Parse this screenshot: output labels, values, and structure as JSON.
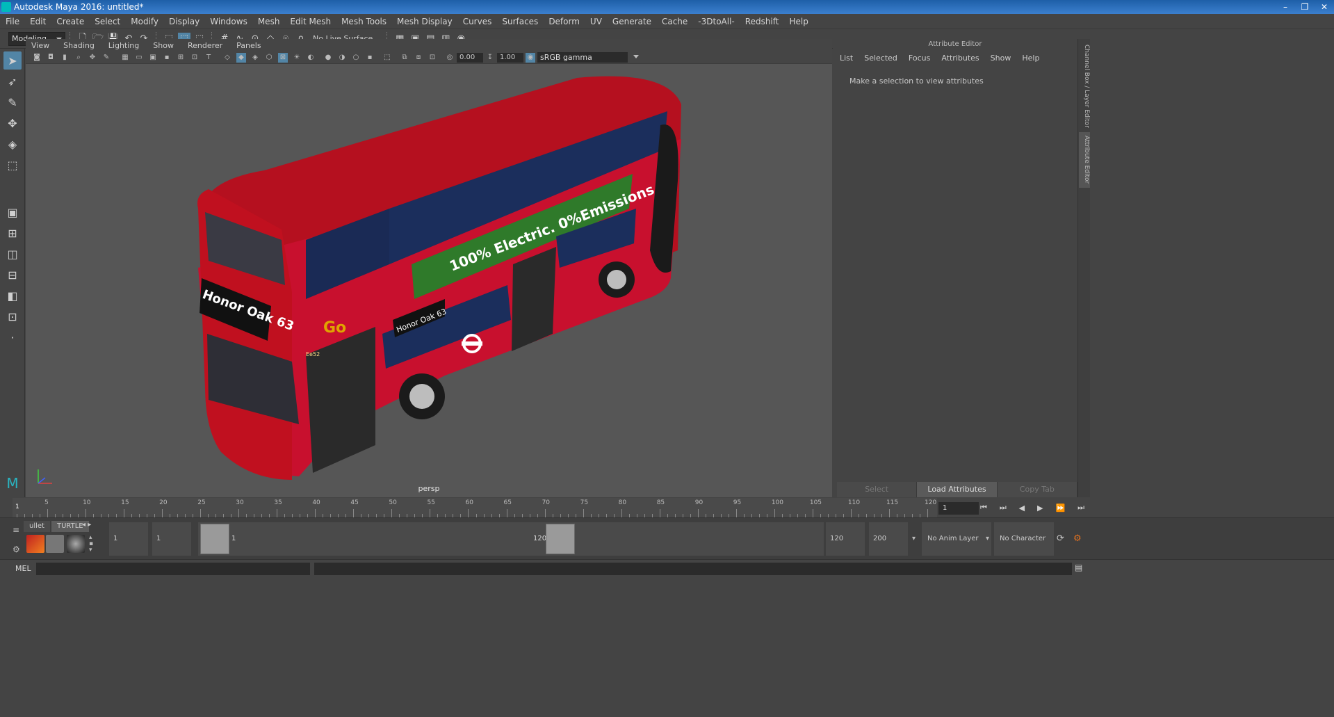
{
  "window": {
    "title": "Autodesk Maya 2016: untitled*",
    "controls": [
      "–",
      "❐",
      "✕"
    ]
  },
  "menubar": [
    "File",
    "Edit",
    "Create",
    "Select",
    "Modify",
    "Display",
    "Windows",
    "Mesh",
    "Edit Mesh",
    "Mesh Tools",
    "Mesh Display",
    "Curves",
    "Surfaces",
    "Deform",
    "UV",
    "Generate",
    "Cache",
    "-3DtoAll-",
    "Redshift",
    "Help"
  ],
  "statusline": {
    "mode": "Modeling",
    "live_surface": "No Live Surface"
  },
  "viewport": {
    "menu": [
      "View",
      "Shading",
      "Lighting",
      "Show",
      "Renderer",
      "Panels"
    ],
    "exposure": "0.00",
    "gamma_value": "1.00",
    "color_space": "sRGB gamma",
    "camera_label": "persp",
    "scene": {
      "front_destination": "Honor Oak 63",
      "side_destination": "Honor Oak 63",
      "ad_text": "100% Electric. 0%Emissions.",
      "operator_logo": "Go",
      "fleet_number": "Ee52"
    }
  },
  "attribute_editor": {
    "header": "Attribute Editor",
    "menu": [
      "List",
      "Selected",
      "Focus",
      "Attributes",
      "Show",
      "Help"
    ],
    "message": "Make a selection to view attributes",
    "buttons": [
      "Select",
      "Load Attributes",
      "Copy Tab"
    ]
  },
  "dock_tabs": [
    "Channel Box / Layer Editor",
    "Attribute Editor"
  ],
  "timeline": {
    "ticks": [
      5,
      10,
      15,
      20,
      25,
      30,
      35,
      40,
      45,
      50,
      55,
      60,
      65,
      70,
      75,
      80,
      85,
      90,
      95,
      100,
      105,
      110,
      115,
      120
    ],
    "current_frame_marker": "1",
    "current_frame": "1",
    "playback_icons": [
      "⏮",
      "⏭",
      "◀",
      "▶",
      "⏩",
      "⏭"
    ]
  },
  "shelf": {
    "tabs": [
      "ullet",
      "TURTLE"
    ]
  },
  "range": {
    "start": "1",
    "playback_start": "1",
    "range_start_label": "1",
    "range_end_label": "120",
    "playback_end": "120",
    "end": "200",
    "anim_layer": "No Anim Layer",
    "character_set": "No Character Set"
  },
  "command_line": {
    "label": "MEL"
  },
  "colors": {
    "bus_red": "#c8102e",
    "accent_blue": "#5285a6",
    "ad_green": "#2f7a2a"
  }
}
